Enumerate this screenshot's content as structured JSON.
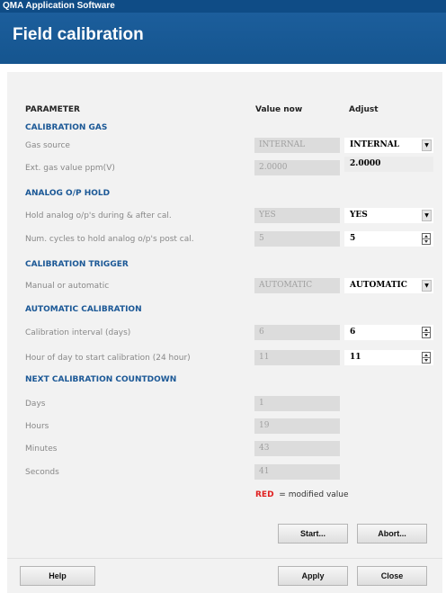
{
  "window": {
    "app_title": "QMA Application Software"
  },
  "header": {
    "title": "Field calibration"
  },
  "columns": {
    "parameter": "PARAMETER",
    "value_now": "Value now",
    "adjust": "Adjust"
  },
  "sections": {
    "calibration_gas": {
      "heading": "CALIBRATION GAS",
      "gas_source": {
        "label": "Gas source",
        "value_now": "INTERNAL",
        "adjust": "INTERNAL"
      },
      "ext_gas": {
        "label": "Ext. gas value ppm(V)",
        "value_now": "2.0000",
        "adjust": "2.0000"
      }
    },
    "analog_hold": {
      "heading": "ANALOG O/P HOLD",
      "hold": {
        "label": "Hold analog o/p's during & after cal.",
        "value_now": "YES",
        "adjust": "YES"
      },
      "cycles": {
        "label": "Num. cycles to hold analog o/p's post cal.",
        "value_now": "5",
        "adjust": "5"
      }
    },
    "trigger": {
      "heading": "CALIBRATION TRIGGER",
      "mode": {
        "label": "Manual or automatic",
        "value_now": "AUTOMATIC",
        "adjust": "AUTOMATIC"
      }
    },
    "automatic": {
      "heading": "AUTOMATIC CALIBRATION",
      "interval": {
        "label": "Calibration interval (days)",
        "value_now": "6",
        "adjust": "6"
      },
      "hour": {
        "label": "Hour of day to start calibration (24 hour)",
        "value_now": "11",
        "adjust": "11"
      }
    },
    "countdown": {
      "heading": "NEXT CALIBRATION COUNTDOWN",
      "days": {
        "label": "Days",
        "value": "1"
      },
      "hours": {
        "label": "Hours",
        "value": "19"
      },
      "minutes": {
        "label": "Minutes",
        "value": "43"
      },
      "seconds": {
        "label": "Seconds",
        "value": "41"
      }
    }
  },
  "legend": {
    "red_word": "RED",
    "text": "= modified value",
    "color": "#e02020"
  },
  "buttons": {
    "start": "Start...",
    "abort": "Abort...",
    "help": "Help",
    "apply": "Apply",
    "close": "Close"
  },
  "icons": {
    "dropdown": "chevron-down-icon",
    "spinner": "spinner-arrows-icon"
  },
  "colors": {
    "title_bar": "#0f4c86",
    "header": "#1c5e9c",
    "section_heading": "#1b5896"
  }
}
